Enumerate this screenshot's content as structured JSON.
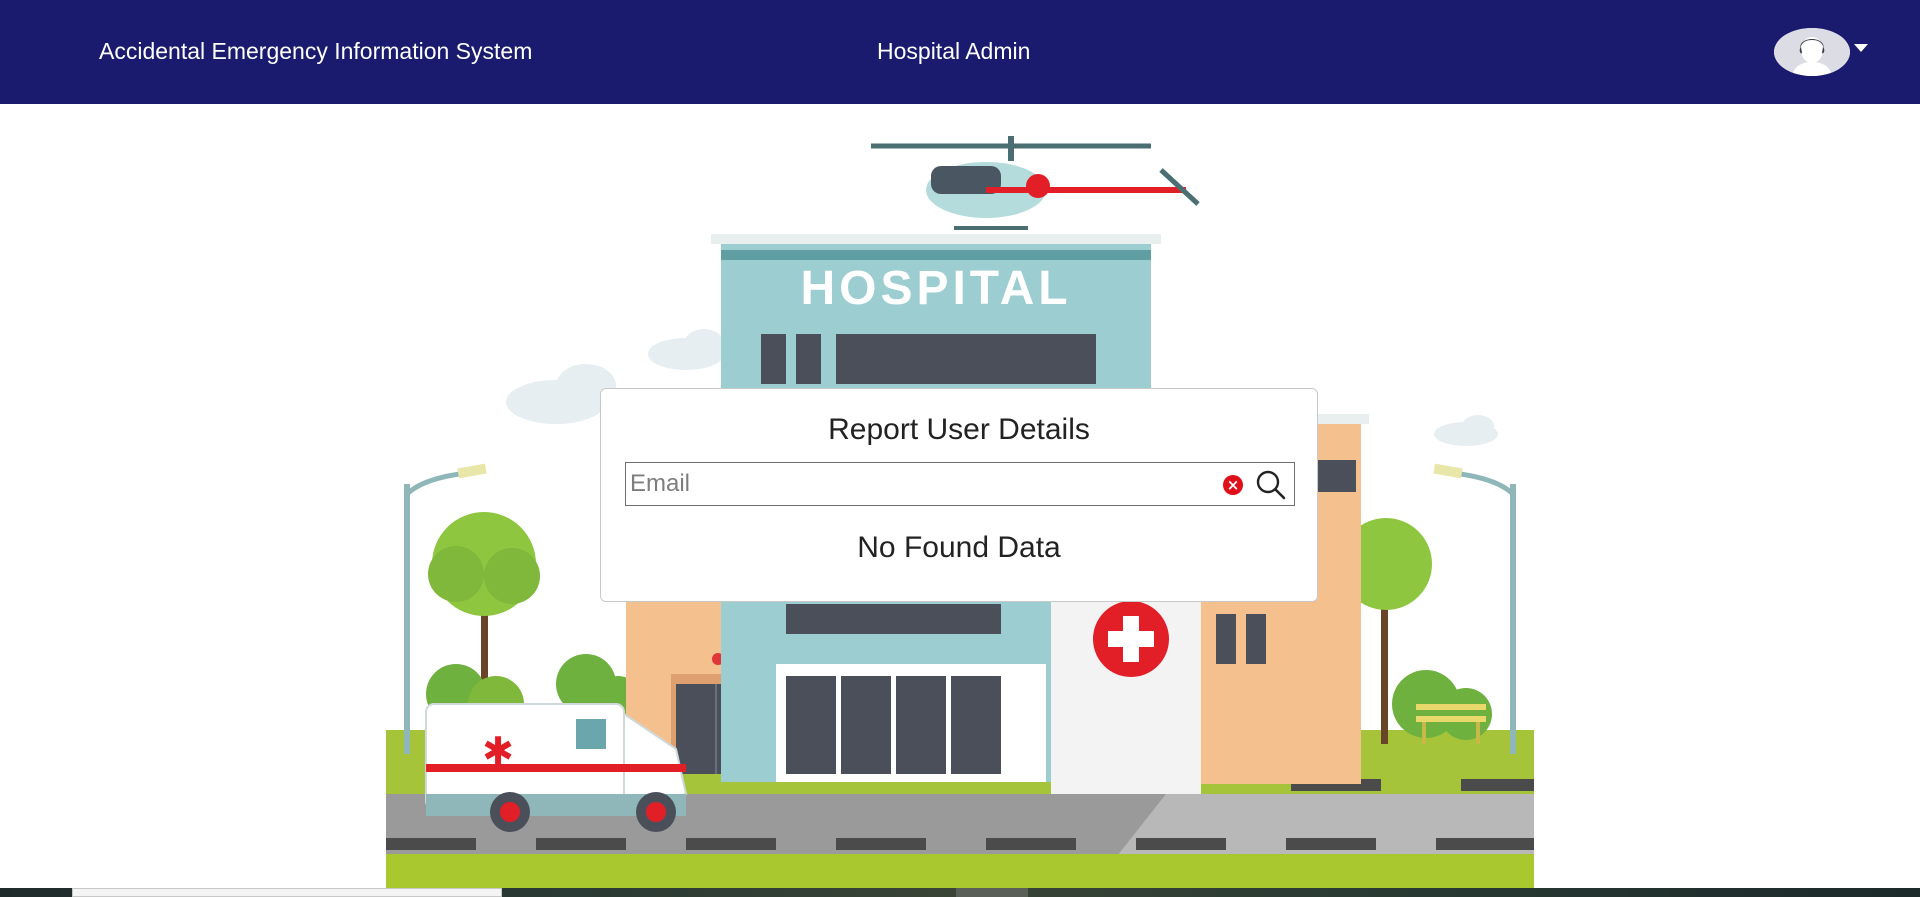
{
  "navbar": {
    "brand": "Accidental Emergency Information System",
    "role": "Hospital Admin",
    "colors": {
      "background": "#1a1a6e",
      "text": "#ffffff"
    },
    "user_menu": {
      "icon": "user-avatar-icon",
      "caret_icon": "caret-down-icon"
    }
  },
  "hero": {
    "sign_text": "HOSPITAL",
    "description": "hospital-illustration"
  },
  "modal": {
    "title": "Report User Details",
    "search": {
      "placeholder": "Email",
      "value": "",
      "clear_icon": "clear-icon",
      "search_icon": "search-icon"
    },
    "empty_message": "No Found Data"
  }
}
